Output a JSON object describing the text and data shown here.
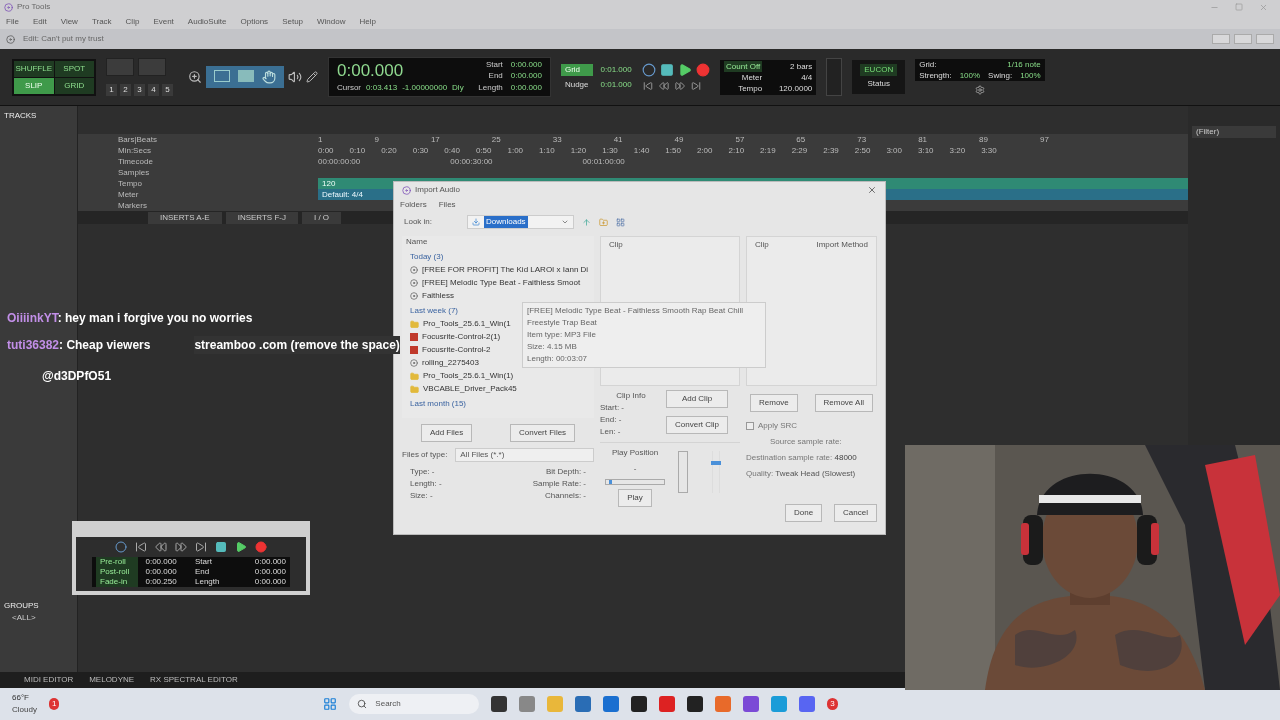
{
  "window": {
    "title": "Pro Tools",
    "menu": [
      "File",
      "Edit",
      "View",
      "Track",
      "Clip",
      "Event",
      "AudioSuite",
      "Options",
      "Setup",
      "Window",
      "Help"
    ]
  },
  "doc_bar": {
    "title": "Edit: Can't put my trust"
  },
  "toolbar": {
    "edit_modes": [
      {
        "label": "SHUFFLE",
        "selected": false
      },
      {
        "label": "SPOT",
        "selected": false
      },
      {
        "label": "SLIP",
        "selected": true
      },
      {
        "label": "GRID",
        "selected": false
      }
    ],
    "zoom_presets": [
      "1",
      "2",
      "3",
      "4",
      "5"
    ],
    "counter": {
      "main": "0:00.000",
      "start_label": "Start",
      "start": "0:00.000",
      "end_label": "End",
      "end": "0:00.000",
      "length_label": "Length",
      "length": "0:00.000",
      "cursor_label": "Cursor",
      "cursor": "0:03.413",
      "value": "-1.00000000",
      "dly": "Dly"
    },
    "grid_label": "Grid",
    "grid_value": "0:01.000",
    "nudge_label": "Nudge",
    "nudge_value": "0:01.000",
    "count_off": "Count Off",
    "bars": "2 bars",
    "meter_label": "Meter",
    "meter": "4/4",
    "tempo_label": "Tempo",
    "tempo": "120.0000",
    "eucon": "EUCON",
    "status_label": "Status",
    "grid_panel": {
      "label": "Grid:",
      "value": "1/16 note",
      "strength_label": "Strength:",
      "strength": "100%",
      "swing_label": "Swing:",
      "swing": "100%"
    }
  },
  "tracks_panel": {
    "title": "TRACKS"
  },
  "groups_panel": {
    "title": "GROUPS",
    "items": [
      "<ALL>"
    ]
  },
  "clips_panel": {
    "filter": "(Filter)"
  },
  "rulers": [
    "Bars|Beats",
    "Min:Secs",
    "Timecode",
    "Samples",
    "Tempo",
    "Meter",
    "Markers"
  ],
  "bar_ticks": [
    "1",
    "9",
    "17",
    "25",
    "33",
    "41",
    "49",
    "57",
    "65",
    "73",
    "81",
    "89",
    "97"
  ],
  "min_ticks": [
    "0:00",
    "0:10",
    "0:20",
    "0:30",
    "0:40",
    "0:50",
    "1:00",
    "1:10",
    "1:20",
    "1:30",
    "1:40",
    "1:50",
    "2:00",
    "2:10",
    "2:19",
    "2:29",
    "2:39",
    "2:50",
    "3:00",
    "3:10",
    "3:20",
    "3:30"
  ],
  "timecode_ticks": [
    "00:00:00:00",
    "00:00:30:00",
    "00:01:00:00"
  ],
  "tempo_marker": "120",
  "meter_marker": "Default: 4/4",
  "insert_tabs": [
    "INSERTS A-E",
    "INSERTS F-J",
    "I / O"
  ],
  "bottom_tabs": [
    "MIDI EDITOR",
    "MELODYNE",
    "RX SPECTRAL EDITOR"
  ],
  "transport": {
    "rows": [
      {
        "label": "Pre-roll",
        "value": "0:00.000",
        "label2": "Start",
        "value2": "0:00.000"
      },
      {
        "label": "Post-roll",
        "value": "0:00.000",
        "label2": "End",
        "value2": "0:00.000"
      },
      {
        "label": "Fade-in",
        "value": "0:00.250",
        "label2": "Length",
        "value2": "0:00.000"
      }
    ]
  },
  "dialog": {
    "title": "Import Audio",
    "menu": [
      "Folders",
      "Files"
    ],
    "look_in_label": "Look in:",
    "look_in": "Downloads",
    "name_header": "Name",
    "groups": [
      {
        "label": "Today (3)",
        "items": [
          {
            "name": "[FREE FOR PROFIT] The Kid LAROI x Iann Di",
            "kind": "audio"
          },
          {
            "name": "[FREE] Melodic Type Beat - Faithless Smoot",
            "kind": "audio"
          },
          {
            "name": "Faithless",
            "kind": "audio"
          }
        ]
      },
      {
        "label": "Last week (7)",
        "items": [
          {
            "name": "Pro_Tools_25.6.1_Win(1",
            "kind": "folder"
          },
          {
            "name": "Focusrite-Control-2(1)",
            "kind": "app"
          },
          {
            "name": "Focusrite-Control-2",
            "kind": "app"
          },
          {
            "name": "rolling_2275403",
            "kind": "audio"
          },
          {
            "name": "Pro_Tools_25.6.1_Win(1)",
            "kind": "folder"
          },
          {
            "name": "VBCABLE_Driver_Pack45",
            "kind": "folder"
          }
        ]
      },
      {
        "label": "Last month (15)"
      }
    ],
    "tooltip": [
      "[FREE] Melodic Type Beat - Faithless Smooth Rap Beat Chill Freestyle Trap Beat",
      "Item type: MP3 File",
      "Size: 4.15 MB",
      "Length: 00:03:07"
    ],
    "clip_header": "Clip",
    "right_headers": [
      "Clip",
      "Import Method"
    ],
    "add_files": "Add Files",
    "convert_files": "Convert Files",
    "files_of_type_label": "Files of type:",
    "files_of_type": "All Files (*.*)",
    "info_left": [
      "Type: -",
      "Length: -",
      "Size: -"
    ],
    "info_right": [
      "Bit Depth: -",
      "Sample Rate: -",
      "Channels: -"
    ],
    "clip_info": "Clip Info",
    "clip_info_rows": [
      "Start: -",
      "End: -",
      "Len: -"
    ],
    "add_clip": "Add Clip",
    "convert_clip": "Convert Clip",
    "play_position": "Play Position",
    "play_position_value": "-",
    "play": "Play",
    "play_slider": {
      "level": 0.05
    },
    "volume_slider": {
      "level": 0.75
    },
    "remove": "Remove",
    "remove_all": "Remove All",
    "apply_src": "Apply SRC",
    "apply_src_checked": false,
    "source_rate_label": "Source sample rate:",
    "dest_rate_label": "Destination sample rate:",
    "dest_rate": "48000",
    "quality_label": "Quality:",
    "quality": "Tweak Head (Slowest)",
    "done": "Done",
    "cancel": "Cancel"
  },
  "chat": [
    {
      "user": "OiiiinkYT",
      "sep": ":",
      "text": "hey man i forgive you no worries"
    },
    {
      "user": "tuti36382",
      "sep": ":",
      "text": "Cheap viewers",
      "extra": "streamboo .com (remove the space)"
    }
  ],
  "chat_handle": "@d3DPfO51",
  "taskbar": {
    "temperature": "66°F",
    "weather": "Cloudy",
    "search": "Search",
    "weather_badge": "1",
    "discord_badge": "3"
  }
}
